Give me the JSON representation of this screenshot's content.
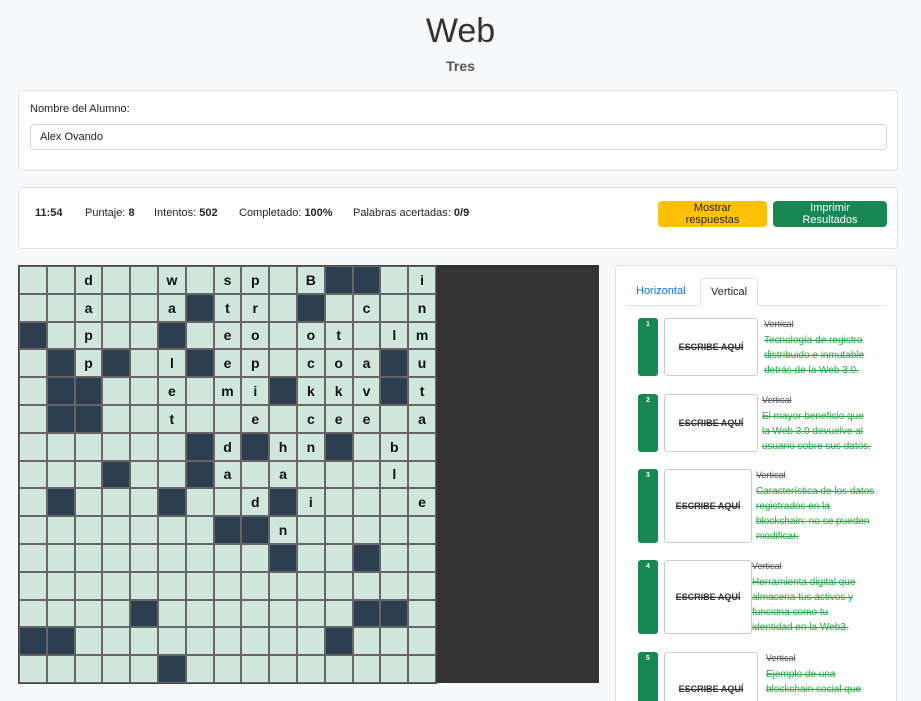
{
  "header": {
    "title": "Web",
    "subtitle": "Tres"
  },
  "student": {
    "label": "Nombre del Alumno:",
    "value": "Alex Ovando"
  },
  "stats": {
    "time": "11:54",
    "score_label": "Puntaje:",
    "score": "8",
    "attempts_label": "Intentos:",
    "attempts": "502",
    "completed_label": "Completado:",
    "completed": "100%",
    "words_label": "Palabras acertadas:",
    "words": "0/9"
  },
  "buttons": {
    "show_answers": "Mostrar respuestas",
    "print_results": "Imprimir Resultados"
  },
  "grid": {
    "rows": [
      "..d..w.sp.B##.i",
      "..a..a#tr.#.c.n",
      "#.p..#.eo.ot.lm",
      ".#p#.l#ep.coa#u",
      ".##..e.mi#kkv#t",
      ".##..t..e.cee.a",
      "......#d#hn#.b.",
      "...#..#a.a...l.",
      ".#...#..d#i...e",
      ".......##n.....",
      ".........#..#..",
      "...............",
      "....#.......##.",
      "##.........#...",
      ".....#........."
    ]
  },
  "tabs": {
    "horizontal": "Horizontal",
    "vertical": "Vertical"
  },
  "clues": [
    {
      "num": "1",
      "box": "ESCRIBE AQUÍ",
      "dir": "Vertical",
      "text": [
        "Tecnología de registro",
        "distribuido e inmutable",
        "detrás de la Web 3.0."
      ]
    },
    {
      "num": "2",
      "box": "ESCRIBE AQUÍ",
      "dir": "Vertical",
      "text": [
        "El mayor beneficio que",
        "la Web 3.0 devuelve al",
        "usuario sobre sus datos."
      ]
    },
    {
      "num": "3",
      "box": "ESCRIBE AQUÍ",
      "dir": "Vertical",
      "text": [
        "Característica de los datos",
        "registrados en la",
        "blockchain: no se pueden",
        "modificar."
      ]
    },
    {
      "num": "4",
      "box": "ESCRIBE AQUÍ",
      "dir": "Vertical",
      "text": [
        "Herramienta digital que",
        "almacena tus activos y",
        "funciona como tu",
        "identidad en la Web3."
      ]
    },
    {
      "num": "5",
      "box": "ESCRIBE AQUÍ",
      "dir": "Vertical",
      "text": [
        "Ejemplo de una",
        "blockchain social que"
      ]
    }
  ]
}
